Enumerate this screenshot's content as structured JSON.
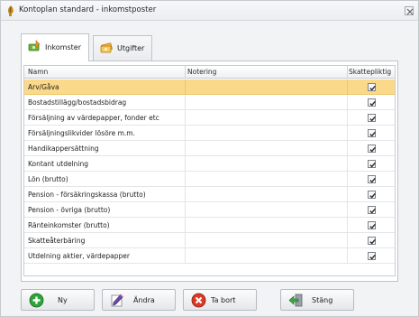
{
  "window": {
    "title": "Kontoplan standard - inkomstposter"
  },
  "tabs": [
    {
      "label": "Inkomster",
      "icon": "income-money-icon",
      "active": true
    },
    {
      "label": "Utgifter",
      "icon": "expense-money-icon",
      "active": false
    }
  ],
  "grid": {
    "columns": {
      "name": "Namn",
      "note": "Notering",
      "taxable": "Skattepliktig"
    },
    "rows": [
      {
        "name": "Arv/Gåva",
        "note": "",
        "taxable": true,
        "selected": true
      },
      {
        "name": "Bostadstillägg/bostadsbidrag",
        "note": "",
        "taxable": true
      },
      {
        "name": "Försäljning av värdepapper, fonder etc",
        "note": "",
        "taxable": true
      },
      {
        "name": "Försäljningslikvider lösöre m.m.",
        "note": "",
        "taxable": true
      },
      {
        "name": "Handikappersättning",
        "note": "",
        "taxable": true
      },
      {
        "name": "Kontant utdelning",
        "note": "",
        "taxable": true
      },
      {
        "name": "Lön (brutto)",
        "note": "",
        "taxable": true
      },
      {
        "name": "Pension - försäkringskassa (brutto)",
        "note": "",
        "taxable": true
      },
      {
        "name": "Pension - övriga (brutto)",
        "note": "",
        "taxable": true
      },
      {
        "name": "Ränteinkomster (brutto)",
        "note": "",
        "taxable": true
      },
      {
        "name": "Skatteåterbäring",
        "note": "",
        "taxable": true
      },
      {
        "name": "Utdelning aktier, värdepapper",
        "note": "",
        "taxable": true
      }
    ]
  },
  "buttons": {
    "new": "Ny",
    "edit": "Ändra",
    "delete": "Ta bort",
    "close": "Stäng"
  },
  "colors": {
    "selected_row": "#fbd98a",
    "new_icon": "#2fa23a",
    "delete_icon": "#d93a25"
  }
}
